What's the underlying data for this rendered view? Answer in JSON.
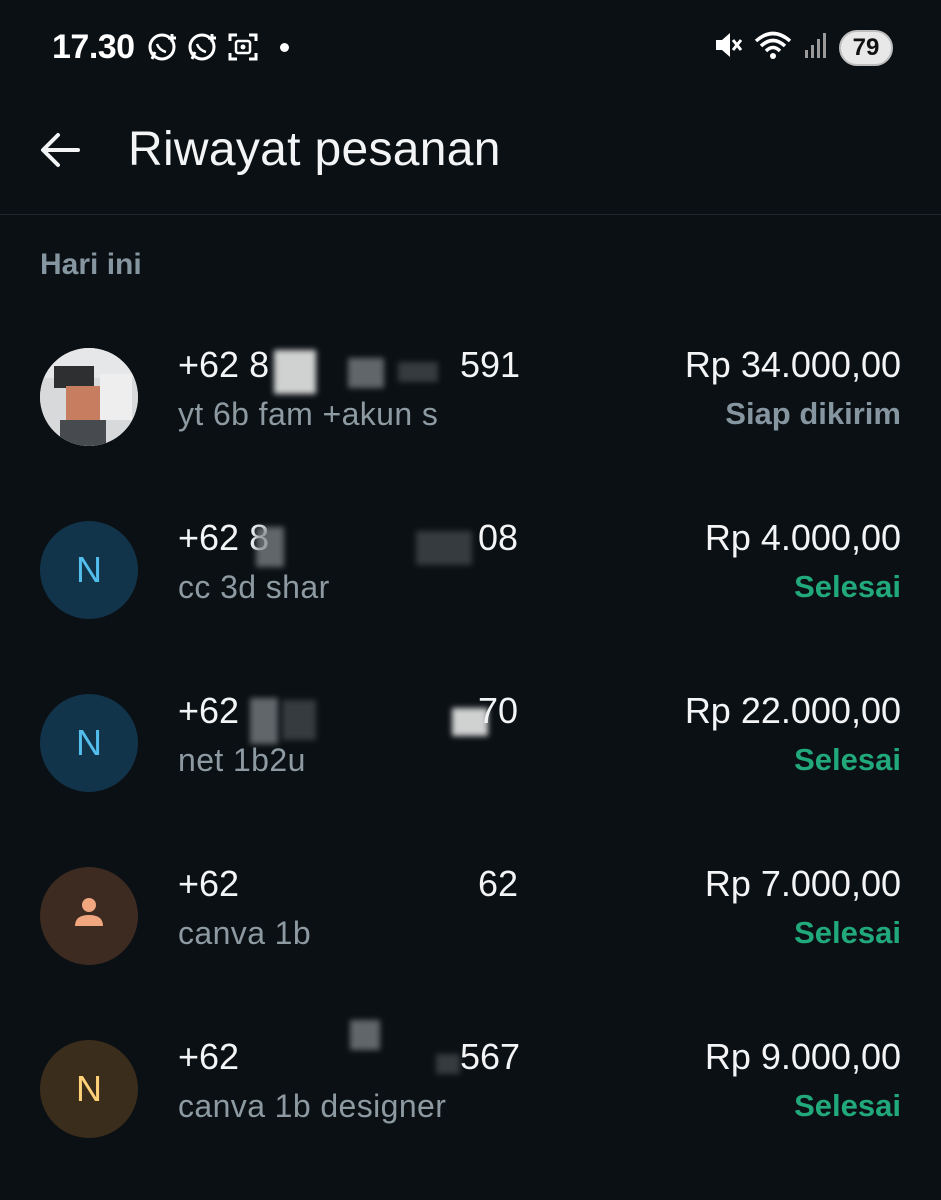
{
  "status_bar": {
    "time": "17.30",
    "battery": "79"
  },
  "header": {
    "title": "Riwayat pesanan"
  },
  "section": {
    "label": "Hari ini"
  },
  "orders": [
    {
      "phone_prefix": "+62 8",
      "phone_suffix": "591",
      "note": "yt 6b fam +akun s",
      "amount": "Rp 34.000,00",
      "status": "Siap dikirim",
      "status_color": "#8696a0",
      "avatar": "photo"
    },
    {
      "phone_prefix": "+62 8",
      "phone_suffix": "08",
      "note": "cc 3d shar",
      "amount": "Rp 4.000,00",
      "status": "Selesai",
      "status_color": "#21a87b",
      "avatar": "N",
      "avatar_color": "#11344a"
    },
    {
      "phone_prefix": "+62",
      "phone_suffix": "70",
      "note": "net 1b2u",
      "amount": "Rp 22.000,00",
      "status": "Selesai",
      "status_color": "#21a87b",
      "avatar": "N",
      "avatar_color": "#11344a"
    },
    {
      "phone_prefix": "+62",
      "phone_suffix": "62",
      "note": "canva 1b",
      "amount": "Rp 7.000,00",
      "status": "Selesai",
      "status_color": "#21a87b",
      "avatar": "person-icon",
      "avatar_color": "#3d2b22"
    },
    {
      "phone_prefix": "+62",
      "phone_suffix": "567",
      "note": "canva 1b designer",
      "amount": "Rp 9.000,00",
      "status": "Selesai",
      "status_color": "#21a87b",
      "avatar": "N",
      "avatar_color": "#3b2d1b"
    }
  ]
}
